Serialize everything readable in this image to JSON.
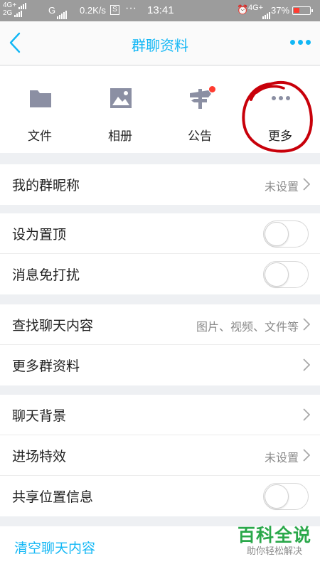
{
  "status_bar": {
    "net_top": "4G+",
    "net_bottom": "2G",
    "carrier_g": "G",
    "speed": "0.2K/s",
    "s_badge": "S",
    "dots": "···",
    "time": "13:41",
    "net_right": "4G+",
    "battery": "37%",
    "battery_level": 0.37
  },
  "header": {
    "title": "群聊资料"
  },
  "shortcuts": [
    {
      "label": "文件",
      "icon": "folder-icon"
    },
    {
      "label": "相册",
      "icon": "photo-album-icon"
    },
    {
      "label": "公告",
      "icon": "announcement-icon"
    },
    {
      "label": "更多",
      "icon": "more-dots-icon"
    }
  ],
  "rows": {
    "nickname": {
      "label": "我的群昵称",
      "value": "未设置"
    },
    "pin": {
      "label": "设为置顶",
      "on": false
    },
    "mute": {
      "label": "消息免打扰",
      "on": false
    },
    "search": {
      "label": "查找聊天内容",
      "value": "图片、视频、文件等"
    },
    "more_info": {
      "label": "更多群资料"
    },
    "background": {
      "label": "聊天背景"
    },
    "entry_effect": {
      "label": "进场特效",
      "value": "未设置"
    },
    "share_location": {
      "label": "共享位置信息",
      "on": false
    },
    "clear": {
      "label": "清空聊天内容"
    }
  },
  "watermark": {
    "big": "百科全说",
    "small": "助你轻松解决"
  },
  "colors": {
    "accent": "#12b7f5",
    "badge": "#ff3b30",
    "annotation": "#c8000a",
    "watermark": "#2aa84a"
  }
}
